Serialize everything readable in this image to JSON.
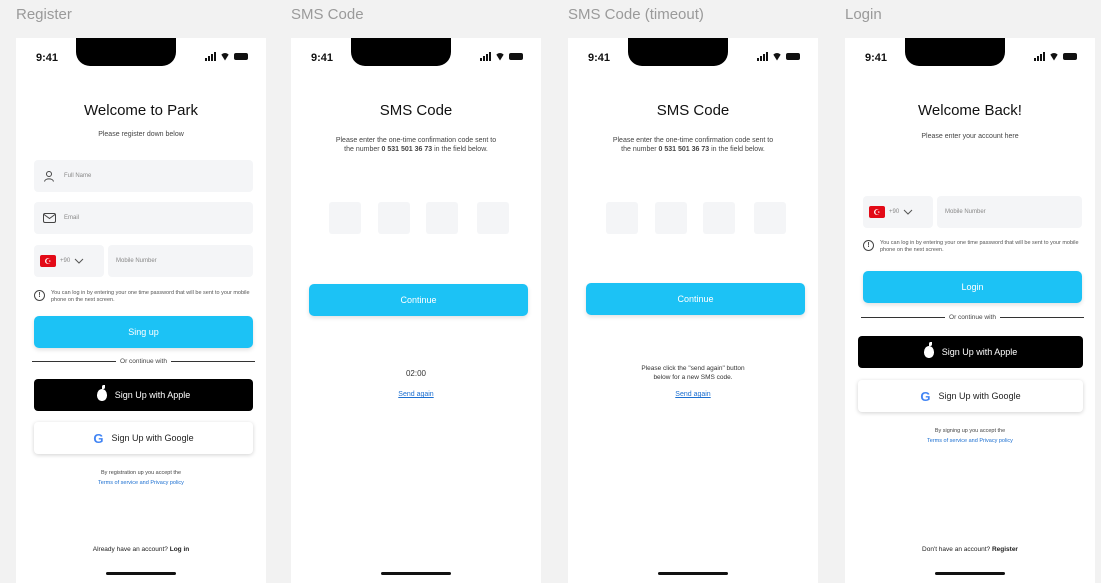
{
  "frames": {
    "register": "Register",
    "sms": "SMS Code",
    "sms_timeout": "SMS Code (timeout)",
    "login": "Login"
  },
  "status_time": "9:41",
  "register": {
    "title": "Welcome to Park",
    "subtitle": "Please register down below",
    "fullname_placeholder": "Full Name",
    "email_placeholder": "Email",
    "country_code": "+90",
    "mobile_placeholder": "Mobile Number",
    "info": "You can log in by entering your one time password that will be sent to your mobile phone on the next screen.",
    "signup_label": "Sing up",
    "or_continue": "Or continue with",
    "apple_label": "Sign Up with Apple",
    "google_label": "Sign Up with Google",
    "terms_prefix": "By registration up you accept the",
    "terms_link": "Terms of service and Privacy policy",
    "bottom_prefix": "Already have an account?",
    "bottom_link": "Log in"
  },
  "sms": {
    "title": "SMS Code",
    "desc_1": "Please enter the one-time confirmation code sent to",
    "desc_2_prefix": "the number",
    "desc_number": "0 531 501 36 73",
    "desc_2_suffix": "in the field below.",
    "continue_label": "Continue",
    "timer": "02:00",
    "send_again": "Send again"
  },
  "sms_timeout": {
    "title": "SMS Code",
    "desc_1": "Please enter the one-time confirmation code sent to",
    "desc_2_prefix": "the number",
    "desc_number": "0 531 501 36 73",
    "desc_2_suffix": "in the field below.",
    "continue_label": "Continue",
    "timeout_msg_1": "Please click the \"send again\" button",
    "timeout_msg_2": "below for a new SMS code.",
    "send_again": "Send again"
  },
  "login": {
    "title": "Welcome Back!",
    "subtitle": "Please enter your account here",
    "country_code": "+90",
    "mobile_placeholder": "Mobile Number",
    "info": "You can log in by entering your one time password that will be sent to your mobile phone on the next screen.",
    "login_label": "Login",
    "or_continue": "Or continue with",
    "apple_label": "Sign Up with Apple",
    "google_label": "Sign Up with Google",
    "terms_prefix": "By signing up you accept the",
    "terms_link": "Terms of service and Privacy policy",
    "bottom_prefix": "Don't have an account?",
    "bottom_link": "Register"
  },
  "colors": {
    "primary": "#1cc2f5",
    "link": "#1b6fd1",
    "flag": "#e30a17"
  }
}
